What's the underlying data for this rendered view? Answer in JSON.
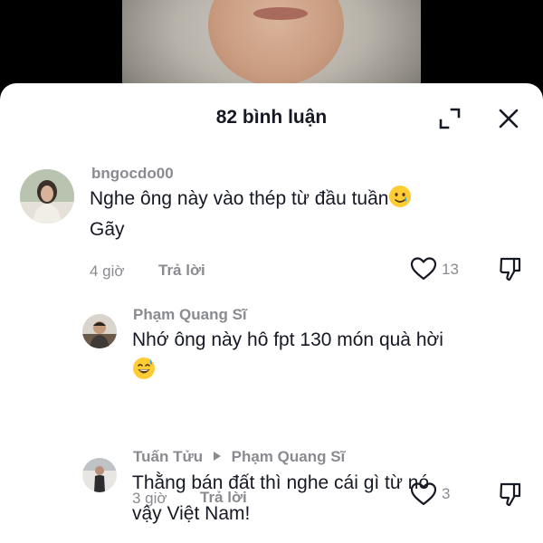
{
  "header": {
    "title": "82 bình luận"
  },
  "comments": [
    {
      "username": "bngocdo00",
      "text_line1": "Nghe ông này vào thép từ đầu tuần",
      "text_line2": "Gãy",
      "time": "4 giờ",
      "reply_label": "Trả lời",
      "likes": "13"
    },
    {
      "username": "Phạm Quang Sĩ",
      "text_line1": "Nhớ ông này hô fpt 130 món quà hời",
      "time": "3 giờ",
      "reply_label": "Trả lời",
      "likes": "3"
    },
    {
      "username": "Tuấn Tửu",
      "reply_to": "Phạm Quang Sĩ",
      "text_line1": "Thằng bán đất thì nghe cái gì từ nó",
      "text_line2": "vậy Việt Nam!"
    }
  ],
  "icons": {
    "expand": "expand-icon",
    "close": "close-icon",
    "like": "heart-icon",
    "dislike": "thumbs-down-icon",
    "reply_arrow": "caret-right-icon"
  },
  "colors": {
    "text": "#161823",
    "secondary": "#8a8b91",
    "background": "#ffffff"
  }
}
